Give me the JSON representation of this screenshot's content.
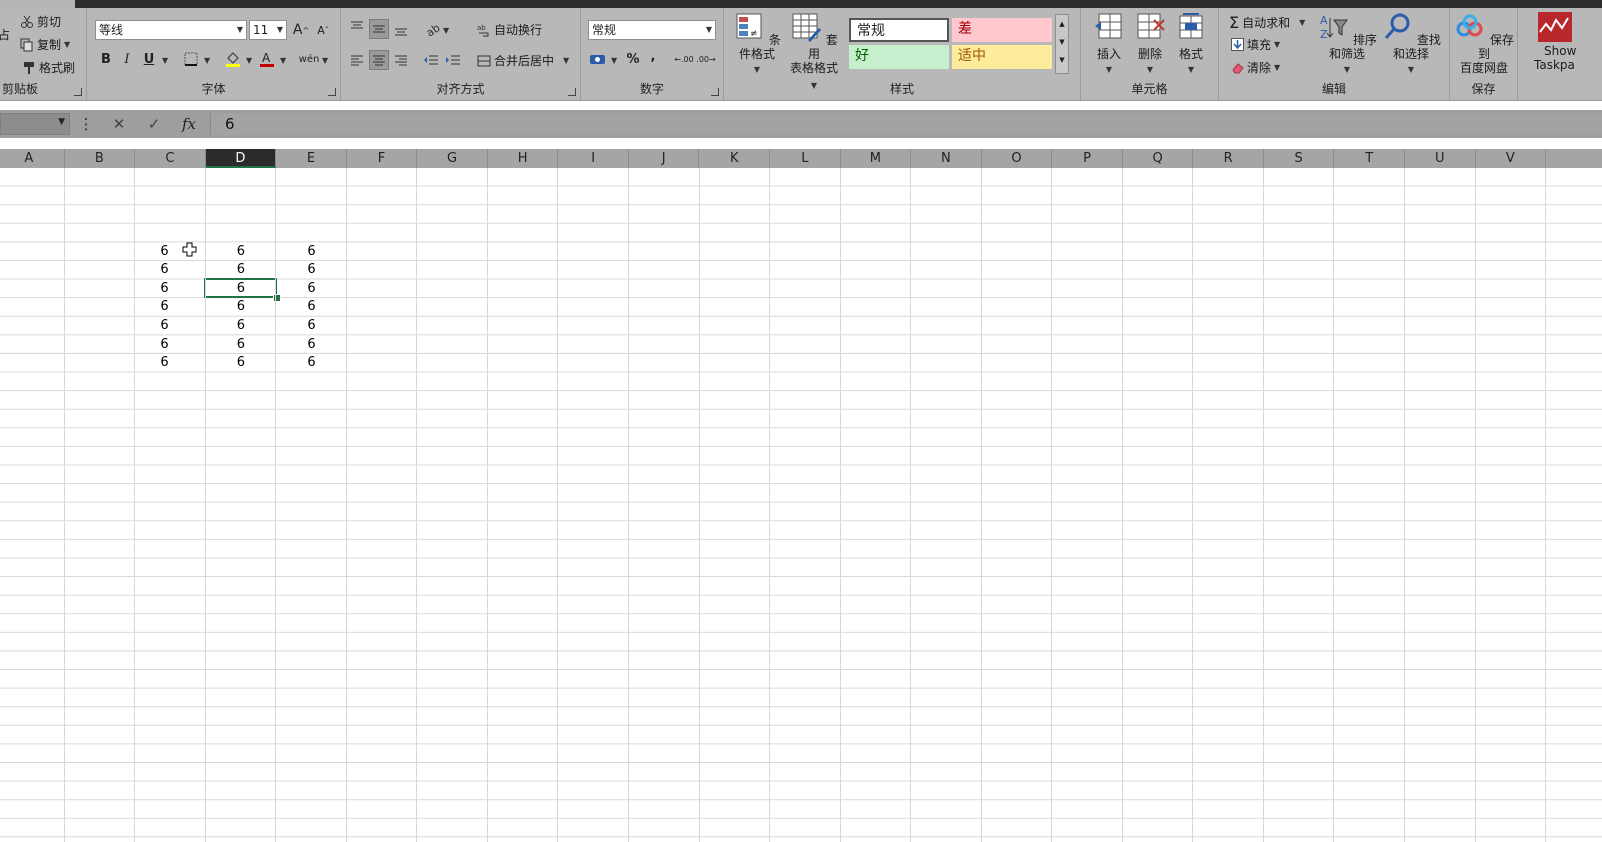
{
  "ribbon": {
    "clipboard": {
      "paste_partial": "占",
      "cut": "剪切",
      "copy": "复制",
      "format_painter": "格式刷",
      "label": "剪贴板"
    },
    "font": {
      "font_name": "等线",
      "font_size": "11",
      "grow": "A",
      "shrink": "A",
      "bold": "B",
      "italic": "I",
      "underline": "U",
      "phonetic": "wén",
      "label": "字体"
    },
    "alignment": {
      "wrap_text": "自动换行",
      "merge_center": "合并后居中",
      "label": "对齐方式"
    },
    "number": {
      "format": "常规",
      "percent": "%",
      "comma": ",",
      "inc_decimal": ".00",
      "dec_decimal": ".00",
      "label": "数字"
    },
    "styles": {
      "conditional_format": "条件格式",
      "format_table_line1": "套用",
      "format_table_line2": "表格格式",
      "normal": "常规",
      "bad": "差",
      "good": "好",
      "neutral": "适中",
      "label": "样式"
    },
    "cells": {
      "insert": "插入",
      "delete": "删除",
      "format": "格式",
      "label": "单元格"
    },
    "editing": {
      "autosum": "自动求和",
      "fill": "填充",
      "clear": "清除",
      "sort_filter": "排序和筛选",
      "find_select": "查找和选择",
      "label": "编辑"
    },
    "save": {
      "line1": "保存到",
      "line2": "百度网盘",
      "label": "保存"
    },
    "addin": {
      "line1": "Show",
      "line2": "Taskpa"
    }
  },
  "formula_bar": {
    "name_box": "",
    "value": "6",
    "fx": "fx"
  },
  "columns": [
    "A",
    "B",
    "C",
    "D",
    "E",
    "F",
    "G",
    "H",
    "I",
    "J",
    "K",
    "L",
    "M",
    "N",
    "O",
    "P",
    "Q",
    "R",
    "S",
    "T",
    "U",
    "V"
  ],
  "active_column": "D",
  "cells": {
    "C": [
      "6",
      "6",
      "6",
      "6",
      "6",
      "6",
      "6"
    ],
    "D": [
      "6",
      "6",
      "6",
      "6",
      "6",
      "6",
      "6"
    ],
    "E": [
      "6",
      "6",
      "6",
      "6",
      "6",
      "6",
      "6"
    ]
  },
  "colors": {
    "selection": "#217346",
    "ribbon_bg": "#b8b8b8",
    "bad_bg": "#ffc7ce",
    "bad_fg": "#9c0006",
    "good_bg": "#c6efce",
    "good_fg": "#006100",
    "neutral_bg": "#ffeb9c",
    "neutral_fg": "#9c5700"
  }
}
